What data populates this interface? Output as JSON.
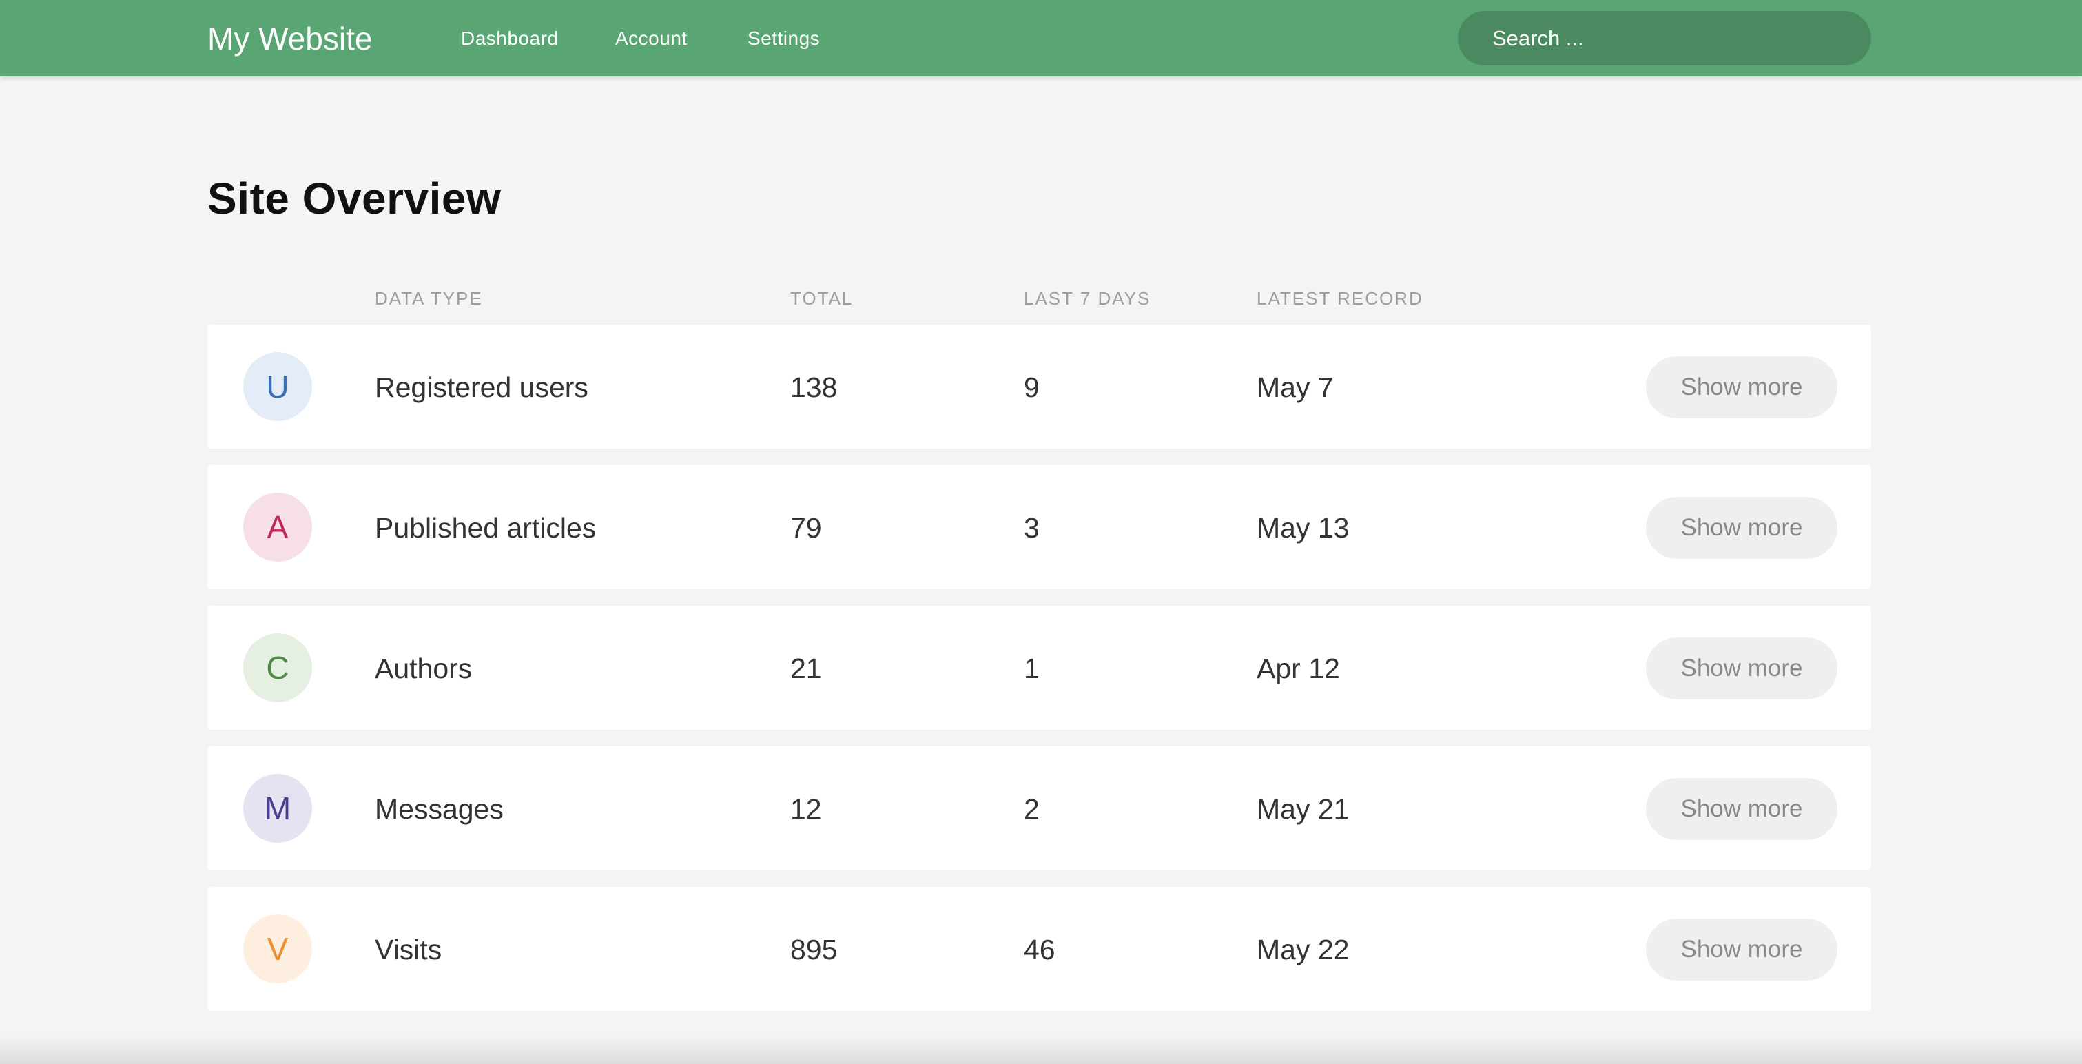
{
  "navbar": {
    "brand": "My Website",
    "links": [
      "Dashboard",
      "Account",
      "Settings"
    ],
    "search_placeholder": "Search ..."
  },
  "page_title": "Site Overview",
  "table": {
    "columns": [
      "DATA TYPE",
      "TOTAL",
      "LAST 7 DAYS",
      "LATEST RECORD"
    ],
    "rows": [
      {
        "letter": "U",
        "type": "Registered users",
        "total": "138",
        "last7": "9",
        "latest": "May 7",
        "button": "Show more",
        "avatar_bg": "#e3ecf7",
        "avatar_fg": "#3a6fb5"
      },
      {
        "letter": "A",
        "type": "Published articles",
        "total": "79",
        "last7": "3",
        "latest": "May 13",
        "button": "Show more",
        "avatar_bg": "#f6dfe6",
        "avatar_fg": "#c0285a"
      },
      {
        "letter": "C",
        "type": "Authors",
        "total": "21",
        "last7": "1",
        "latest": "Apr 12",
        "button": "Show more",
        "avatar_bg": "#e5efe2",
        "avatar_fg": "#4f8a45"
      },
      {
        "letter": "M",
        "type": "Messages",
        "total": "12",
        "last7": "2",
        "latest": "May 21",
        "button": "Show more",
        "avatar_bg": "#e5e2f1",
        "avatar_fg": "#4d3f96"
      },
      {
        "letter": "V",
        "type": "Visits",
        "total": "895",
        "last7": "46",
        "latest": "May 22",
        "button": "Show more",
        "avatar_bg": "#fdeedf",
        "avatar_fg": "#e8912e"
      }
    ]
  },
  "colors": {
    "navbar_bg": "#5aa574",
    "search_bg": "#4b8a60",
    "page_bg": "#f4f4f4"
  }
}
